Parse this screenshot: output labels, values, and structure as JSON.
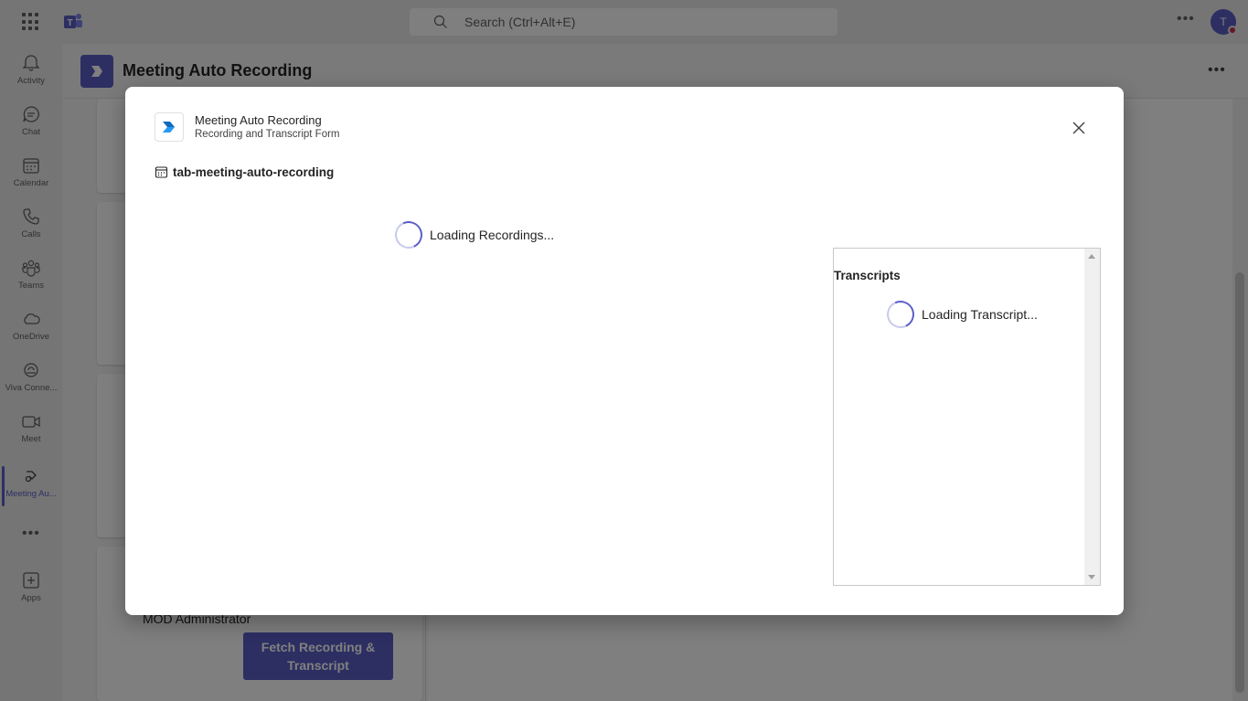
{
  "topbar": {
    "search_placeholder": "Search (Ctrl+Alt+E)",
    "avatar_initial": "T"
  },
  "rail": {
    "items": [
      {
        "label": "Activity",
        "icon": "bell-icon"
      },
      {
        "label": "Chat",
        "icon": "chat-icon"
      },
      {
        "label": "Calendar",
        "icon": "calendar-icon"
      },
      {
        "label": "Calls",
        "icon": "phone-icon"
      },
      {
        "label": "Teams",
        "icon": "teams-icon"
      },
      {
        "label": "OneDrive",
        "icon": "cloud-icon"
      },
      {
        "label": "Viva Conne...",
        "icon": "viva-connections-icon"
      },
      {
        "label": "Meet",
        "icon": "video-icon"
      },
      {
        "label": "Meeting Au...",
        "icon": "meeting-app-icon"
      },
      {
        "label": "Apps",
        "icon": "add-app-icon"
      }
    ]
  },
  "app_header": {
    "title": "Meeting Auto Recording"
  },
  "background": {
    "organizer": "MOD Administrator",
    "fetch_button": "Fetch Recording & Transcript"
  },
  "dialog": {
    "app_name": "Meeting Auto Recording",
    "subtitle": "Recording and Transcript Form",
    "heading": "tab-meeting-auto-recording",
    "loading_recordings": "Loading Recordings...",
    "transcripts_title": "Transcripts",
    "loading_transcript": "Loading Transcript..."
  },
  "colors": {
    "accent": "#5b5fc7",
    "overlay": "rgba(0,0,0,0.5)"
  }
}
